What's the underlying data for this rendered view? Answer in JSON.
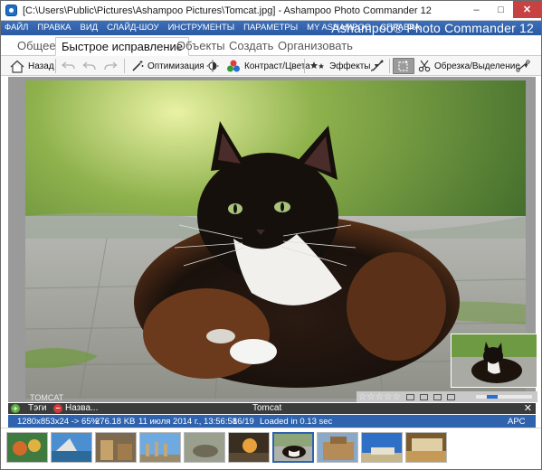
{
  "window": {
    "title": "[C:\\Users\\Public\\Pictures\\Ashampoo Pictures\\Tomcat.jpg] - Ashampoo Photo Commander 12",
    "minimize": "–",
    "maximize": "□",
    "close": "✕"
  },
  "menu": {
    "items": [
      "ФАЙЛ",
      "ПРАВКА",
      "ВИД",
      "СЛАЙД-ШОУ",
      "ИНСТРУМЕНТЫ",
      "ПАРАМЕТРЫ",
      "MY ASHAMPOO",
      "СПРАВКА"
    ],
    "brand": "Ashampoo® Photo Commander 12"
  },
  "tabs": [
    {
      "label": "Общее",
      "active": false
    },
    {
      "label": "Быстрое исправление",
      "active": true
    },
    {
      "label": "Объекты",
      "active": false
    },
    {
      "label": "Создать",
      "active": false
    },
    {
      "label": "Организовать",
      "active": false
    }
  ],
  "toolbar": {
    "back": "Назад",
    "optimize": "Оптимизация",
    "contrast": "Контраст/Цвета",
    "effects": "Эффекты",
    "crop": "Обрезка/Выделение",
    "icons": [
      "home-icon",
      "undo-all-icon",
      "undo-icon",
      "redo-icon",
      "magic-wand-icon",
      "brightness-icon",
      "color-dots-icon",
      "stars-icon",
      "brush-icon",
      "crop-selection-icon",
      "scissors-icon",
      "straighten-icon"
    ]
  },
  "viewer": {
    "image_label": "TOMCAT",
    "stars": "☆☆☆☆☆",
    "zoom_position": 0.2
  },
  "filmstrip": {
    "plus": "+",
    "tags": "Тэги",
    "minus": "–",
    "name": "Назва...",
    "center_title": "Tomcat",
    "close": "✕"
  },
  "info": {
    "dimensions": "1280x853x24 -> 65%",
    "size": "276.18 KB",
    "date": "11 июля 2014 г., 13:56:58",
    "index": "16/19",
    "loaded": "Loaded in 0.13 sec",
    "mode": "APC"
  },
  "colors": {
    "menubar": "#2f63ad",
    "accent": "#2a6fcb",
    "close_button": "#c74343"
  }
}
